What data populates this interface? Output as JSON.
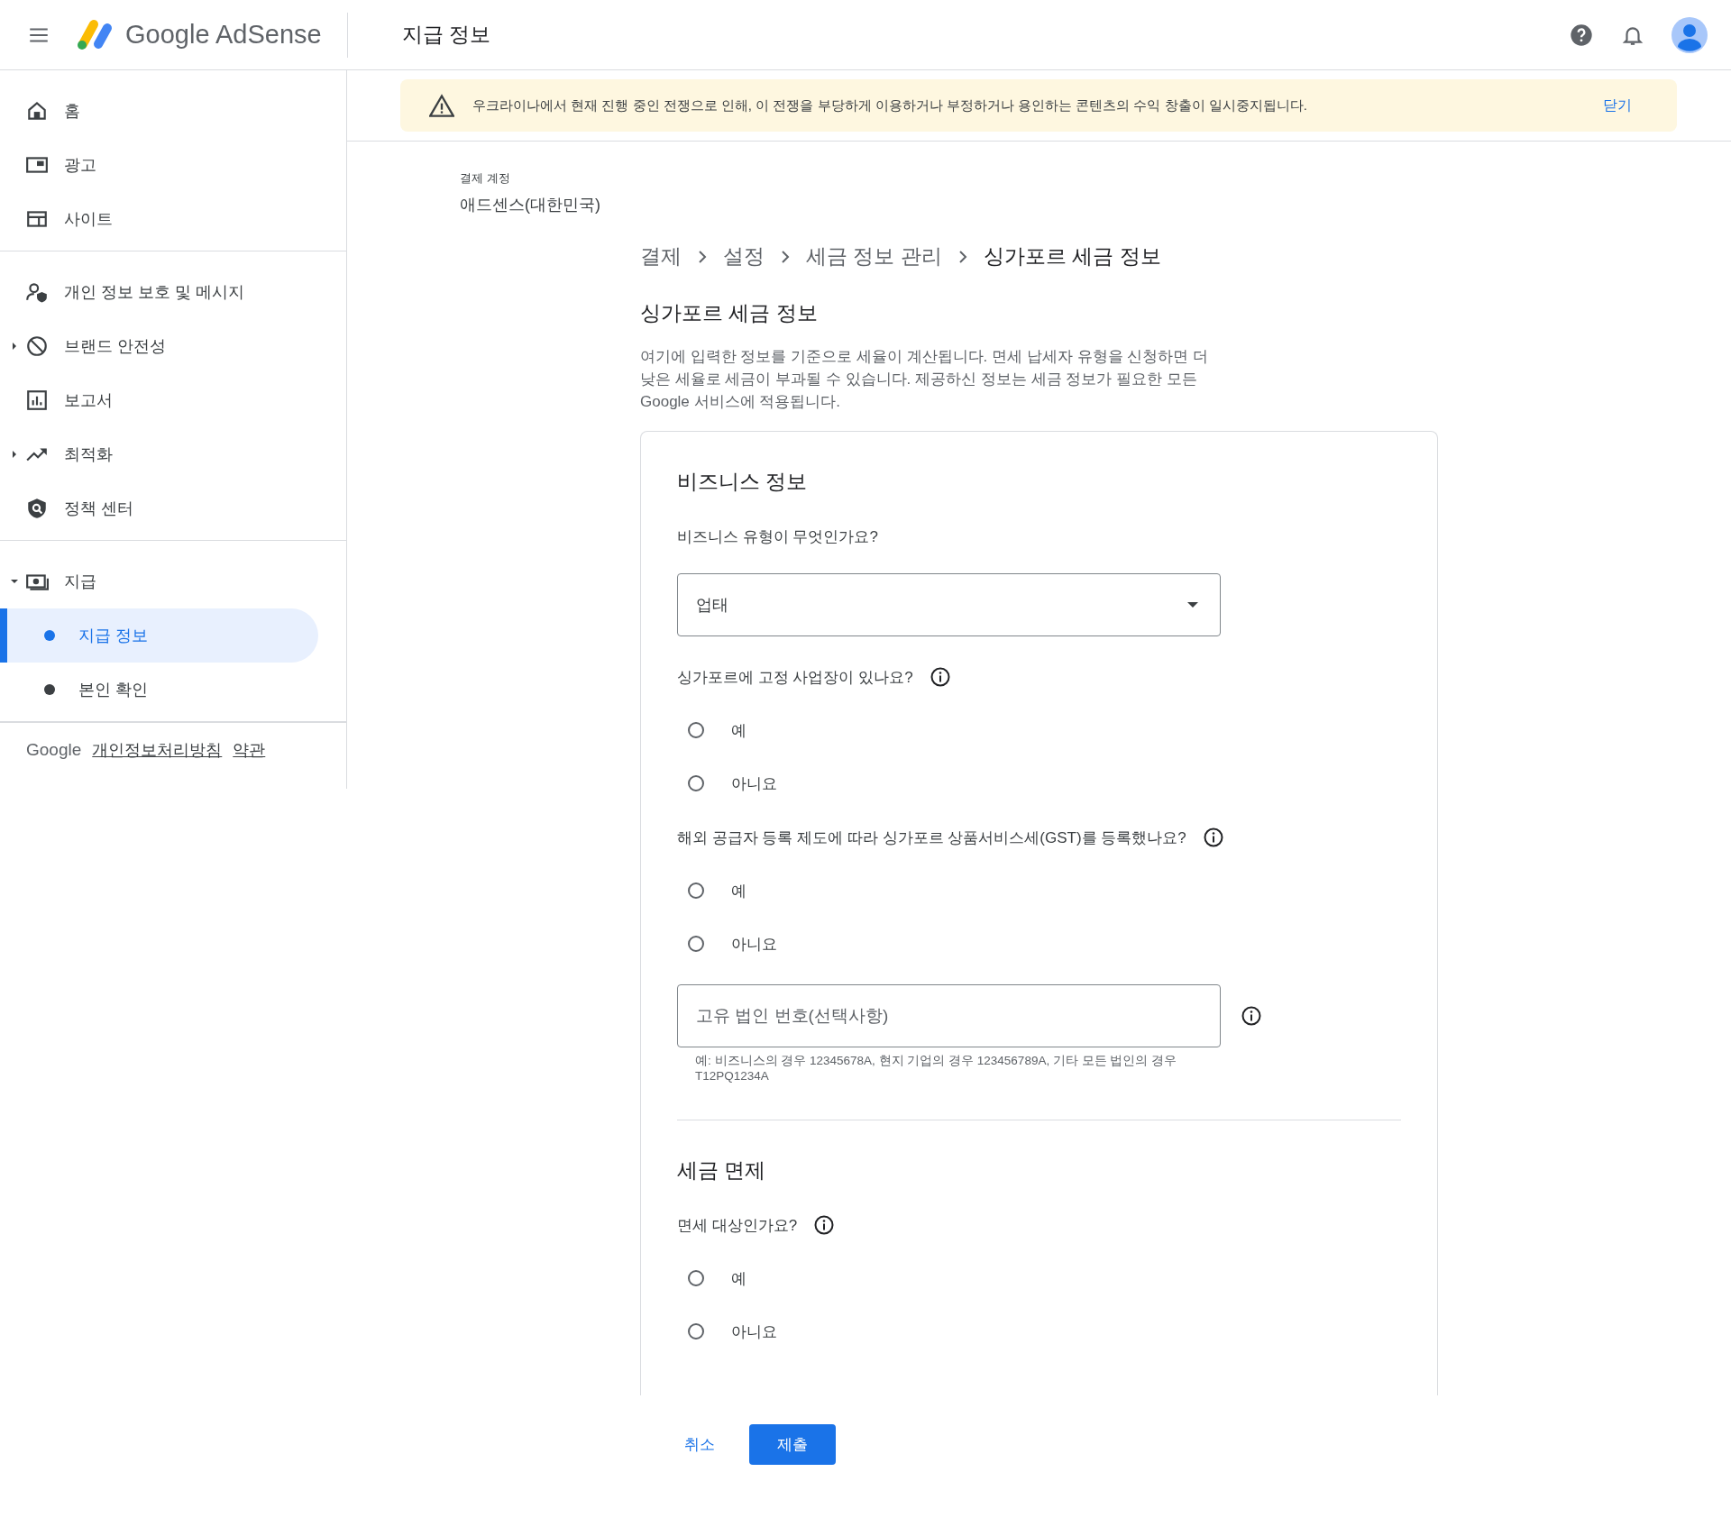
{
  "header": {
    "product": "Google AdSense",
    "page_title": "지급 정보"
  },
  "sidebar": {
    "groups": [
      [
        {
          "label": "홈",
          "kind": "link",
          "selected": false
        },
        {
          "label": "광고",
          "kind": "link",
          "selected": false
        },
        {
          "label": "사이트",
          "kind": "link",
          "selected": false
        }
      ],
      [
        {
          "label": "개인 정보 보호 및 메시지",
          "kind": "link",
          "selected": false
        },
        {
          "label": "브랜드 안전성",
          "kind": "group",
          "expanded": false,
          "selected": false
        },
        {
          "label": "보고서",
          "kind": "link",
          "selected": false
        },
        {
          "label": "최적화",
          "kind": "group",
          "expanded": false,
          "selected": false
        },
        {
          "label": "정책 센터",
          "kind": "link",
          "selected": false
        }
      ],
      [
        {
          "label": "지급",
          "kind": "group",
          "expanded": true,
          "selected": false,
          "children": [
            {
              "label": "지급 정보",
              "selected": true
            },
            {
              "label": "본인 확인",
              "selected": false
            }
          ]
        }
      ]
    ],
    "footer": {
      "brand": "Google",
      "links": [
        "개인정보처리방침",
        "약관"
      ]
    }
  },
  "banner": {
    "text": "우크라이나에서 현재 진행 중인 전쟁으로 인해, 이 전쟁을 부당하게 이용하거나 부정하거나 용인하는 콘텐츠의 수익 창출이 일시중지됩니다.",
    "action": "닫기"
  },
  "billing_account": {
    "label": "결제 계정",
    "value": "애드센스(대한민국)"
  },
  "breadcrumb": [
    "결제",
    "설정",
    "세금 정보 관리",
    "싱가포르 세금 정보"
  ],
  "title": "싱가포르 세금 정보",
  "description": "여기에 입력한 정보를 기준으로 세율이 계산됩니다. 면세 납세자 유형을 신청하면 더 낮은 세율로 세금이 부과될 수 있습니다. 제공하신 정보는 세금 정보가 필요한 모든 Google 서비스에 적용됩니다.",
  "sections": [
    {
      "heading": "비즈니스 정보",
      "fields": [
        {
          "kind": "select",
          "label": "비즈니스 유형이 무엇인가요?",
          "info": false,
          "value": "업태"
        },
        {
          "kind": "radio",
          "label": "싱가포르에 고정 사업장이 있나요?",
          "info": true,
          "options": [
            {
              "label": "예",
              "selected": false
            },
            {
              "label": "아니요",
              "selected": false
            }
          ]
        },
        {
          "kind": "radio",
          "label": "해외 공급자 등록 제도에 따라 싱가포르 상품서비스세(GST)를 등록했나요?",
          "info": true,
          "options": [
            {
              "label": "예",
              "selected": false
            },
            {
              "label": "아니요",
              "selected": false
            }
          ]
        },
        {
          "kind": "text",
          "placeholder": "고유 법인 번호(선택사항)",
          "info": true,
          "hint": "예: 비즈니스의 경우 12345678A, 현지 기업의 경우 123456789A, 기타 모든 법인의 경우 T12PQ1234A"
        }
      ]
    },
    {
      "heading": "세금 면제",
      "fields": [
        {
          "kind": "radio",
          "label": "면세 대상인가요?",
          "info": true,
          "options": [
            {
              "label": "예",
              "selected": false
            },
            {
              "label": "아니요",
              "selected": false
            }
          ]
        }
      ]
    }
  ],
  "actions": [
    {
      "kind": "text",
      "label": "취소"
    },
    {
      "kind": "filled",
      "label": "제출"
    }
  ]
}
